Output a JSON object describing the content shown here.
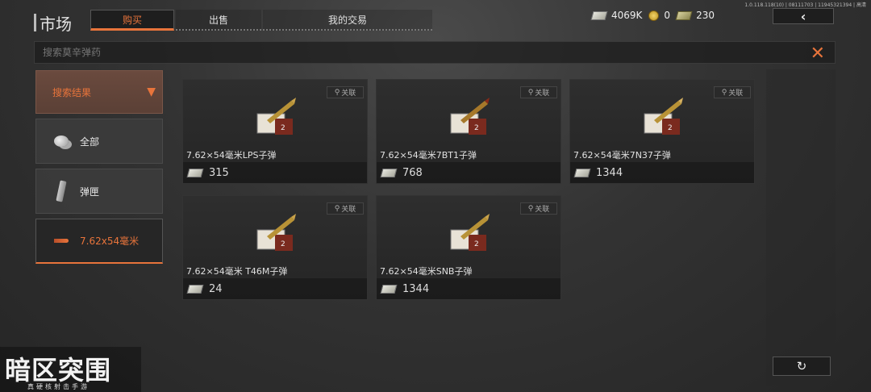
{
  "version": "1.0.118.118(10) | 08111703 | 11945321394 | 高清",
  "title": "市场",
  "tabs": [
    {
      "label": "购买",
      "active": true
    },
    {
      "label": "出售",
      "active": false
    },
    {
      "label": "我的交易",
      "active": false
    }
  ],
  "currencies": [
    {
      "icon": "cash-icon",
      "value": "4069K"
    },
    {
      "icon": "gold-coin-icon",
      "value": "0"
    },
    {
      "icon": "dollar-bill-icon",
      "value": "230"
    }
  ],
  "back_icon": "‹",
  "search": {
    "placeholder": "搜索莫辛弹药",
    "value": ""
  },
  "sidebar": {
    "header": "搜索结果",
    "items": [
      {
        "label": "全部",
        "icon": "coins-icon"
      },
      {
        "label": "弹匣",
        "icon": "magazine-icon"
      },
      {
        "label": "7.62x54毫米",
        "icon": "bullet-icon",
        "selected": true
      }
    ]
  },
  "link_label": "关联",
  "items": [
    {
      "name": "7.62×54毫米LPS子弹",
      "price": "315"
    },
    {
      "name": "7.62×54毫米7BT1子弹",
      "price": "768"
    },
    {
      "name": "7.62×54毫米7N37子弹",
      "price": "1344"
    },
    {
      "name": "7.62×54毫米 T46M子弹",
      "price": "24"
    },
    {
      "name": "7.62×54毫米SNB子弹",
      "price": "1344"
    }
  ],
  "logo": {
    "main": "暗区突围",
    "sub": "真硬核射击手游"
  },
  "colors": {
    "accent": "#e8743b",
    "background": "#333333"
  }
}
